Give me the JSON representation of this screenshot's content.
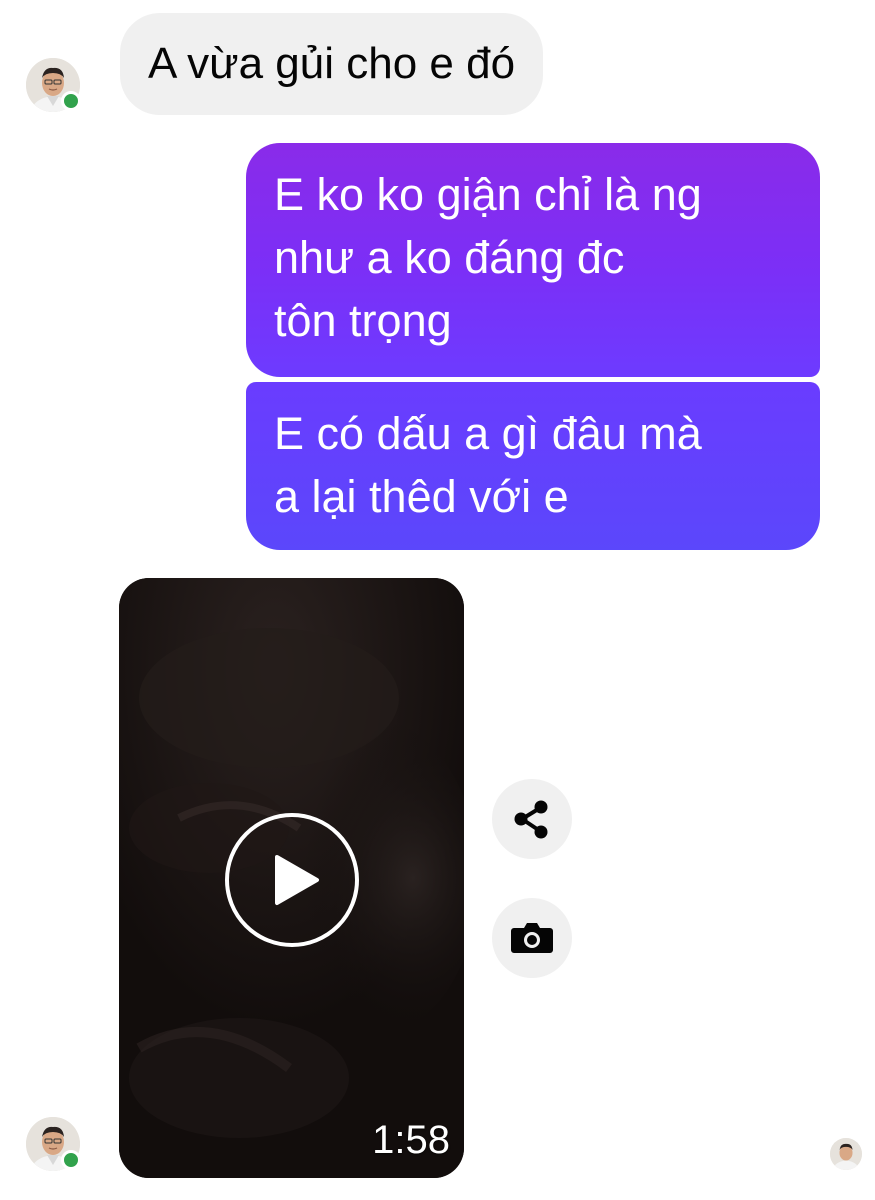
{
  "messages": [
    {
      "direction": "incoming",
      "text": "A vừa gủi cho e đó"
    },
    {
      "direction": "outgoing",
      "lines": [
        "E ko ko giận chỉ là ng",
        "như a ko đáng đc",
        "tôn trọng"
      ]
    },
    {
      "direction": "outgoing",
      "lines": [
        "E có dấu a gì đâu mà",
        "a lại thêd với e"
      ]
    }
  ],
  "video": {
    "duration": "1:58"
  },
  "icons": {
    "share": "share-icon",
    "camera": "camera-icon",
    "play": "play-icon"
  },
  "colors": {
    "incoming_bubble": "#f0f0f0",
    "outgoing_bubble_top": "#8a2be9",
    "outgoing_bubble_bottom": "#5b47fb",
    "online_status": "#31a24c",
    "action_button": "#f0f0f0"
  }
}
